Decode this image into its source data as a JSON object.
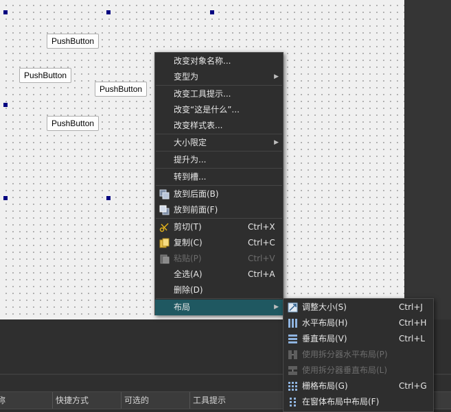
{
  "canvas": {
    "buttons": [
      "PushButton",
      "PushButton",
      "PushButton",
      "PushButton"
    ]
  },
  "table": {
    "headers": [
      "名称",
      "快捷方式",
      "可选的",
      "工具提示"
    ]
  },
  "context_menu": {
    "items": [
      {
        "label": "改变对象名称..."
      },
      {
        "label": "变型为",
        "submenu": true
      },
      {
        "label": "改变工具提示..."
      },
      {
        "label": "改变“这是什么”..."
      },
      {
        "label": "改变样式表..."
      },
      {
        "label": "大小限定",
        "submenu": true
      },
      {
        "label": "提升为..."
      },
      {
        "label": "转到槽..."
      },
      {
        "label": "放到后面(B)",
        "icon": "send-to-back-icon"
      },
      {
        "label": "放到前面(F)",
        "icon": "bring-to-front-icon"
      },
      {
        "label": "剪切(T)",
        "shortcut": "Ctrl+X",
        "icon": "scissors-icon"
      },
      {
        "label": "复制(C)",
        "shortcut": "Ctrl+C",
        "icon": "copy-icon"
      },
      {
        "label": "粘贴(P)",
        "shortcut": "Ctrl+V",
        "icon": "paste-icon",
        "disabled": true
      },
      {
        "label": "全选(A)",
        "shortcut": "Ctrl+A"
      },
      {
        "label": "删除(D)"
      },
      {
        "label": "布局",
        "submenu": true,
        "highlighted": true
      }
    ]
  },
  "layout_submenu": {
    "items": [
      {
        "label": "调整大小(S)",
        "shortcut": "Ctrl+J",
        "icon": "adjust-size-icon"
      },
      {
        "label": "水平布局(H)",
        "shortcut": "Ctrl+H",
        "icon": "horizontal-layout-icon"
      },
      {
        "label": "垂直布局(V)",
        "shortcut": "Ctrl+L",
        "icon": "vertical-layout-icon"
      },
      {
        "label": "使用拆分器水平布局(P)",
        "disabled": true,
        "icon": "horizontal-splitter-icon"
      },
      {
        "label": "使用拆分器垂直布局(L)",
        "disabled": true,
        "icon": "vertical-splitter-icon"
      },
      {
        "label": "栅格布局(G)",
        "shortcut": "Ctrl+G",
        "icon": "grid-layout-icon"
      },
      {
        "label": "在窗体布局中布局(F)",
        "icon": "form-layout-icon"
      }
    ]
  },
  "colors": {
    "highlight": "#1f5861",
    "selection_handle": "#000080",
    "menu_bg": "#2e2e2e"
  }
}
